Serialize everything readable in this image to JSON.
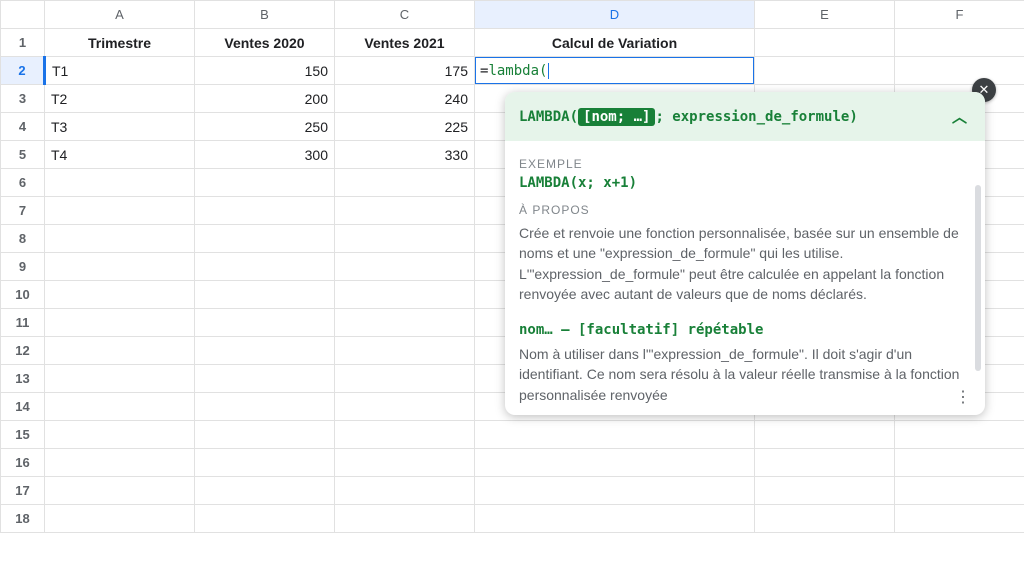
{
  "columns": [
    "A",
    "B",
    "C",
    "D",
    "E",
    "F"
  ],
  "row_count": 18,
  "selected_col": "D",
  "selected_row": 2,
  "headers": {
    "A": "Trimestre",
    "B": "Ventes 2020",
    "C": "Ventes 2021",
    "D": "Calcul de Variation"
  },
  "rows": [
    {
      "A": "T1",
      "B": "150",
      "C": "175",
      "D_formula": "=lambda("
    },
    {
      "A": "T2",
      "B": "200",
      "C": "240"
    },
    {
      "A": "T3",
      "B": "250",
      "C": "225"
    },
    {
      "A": "T4",
      "B": "300",
      "C": "330"
    }
  ],
  "tooltip": {
    "sig_fn": "LAMBDA(",
    "sig_hl": "[nom; …]",
    "sig_rest": "; expression_de_formule)",
    "sect_example_label": "EXEMPLE",
    "example": "LAMBDA(x; x+1)",
    "sect_about_label": "À PROPOS",
    "about": "Crée et renvoie une fonction personnalisée, basée sur un ensemble de noms et une \"expression_de_formule\" qui les utilise. L'\"expression_de_formule\" peut être calculée en appelant la fonction renvoyée avec autant de valeurs que de noms déclarés.",
    "param_hdr": "nom… – [facultatif] répétable",
    "param_desc": "Nom à utiliser dans l'\"expression_de_formule\". Il doit s'agir d'un identifiant. Ce nom sera résolu à la valeur réelle transmise à la fonction personnalisée renvoyée"
  },
  "icons": {
    "chevron_up": "⌃",
    "close": "✕",
    "kebab": "⋮"
  }
}
